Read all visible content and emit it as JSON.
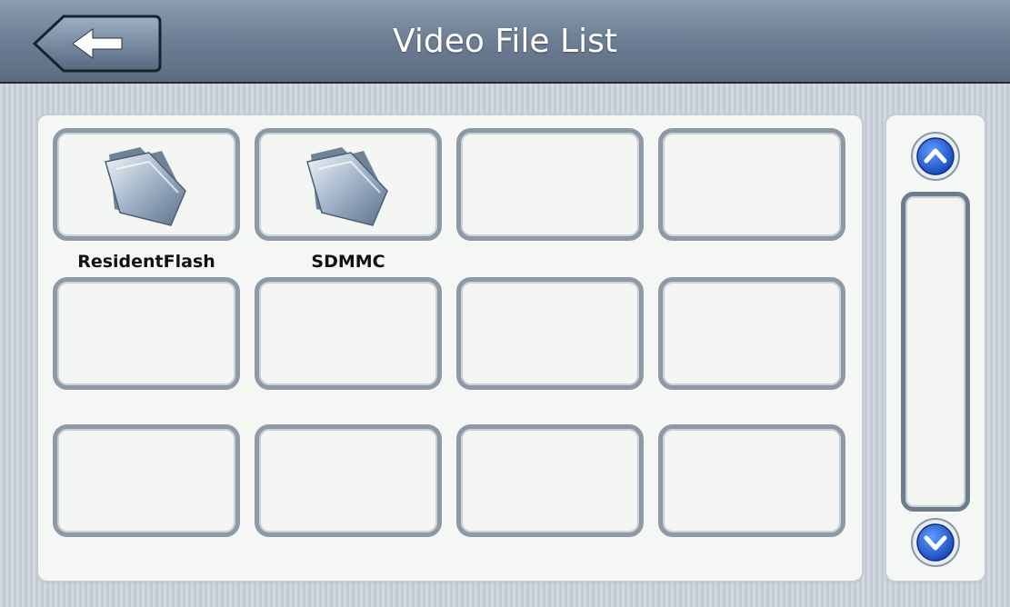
{
  "header": {
    "title": "Video File List",
    "back_icon": "back-arrow-icon"
  },
  "file_grid": {
    "items": [
      {
        "label": "ResidentFlash",
        "icon": "folder-icon"
      },
      {
        "label": "SDMMC",
        "icon": "folder-icon"
      },
      {
        "label": "",
        "icon": ""
      },
      {
        "label": "",
        "icon": ""
      },
      {
        "label": "",
        "icon": ""
      },
      {
        "label": "",
        "icon": ""
      },
      {
        "label": "",
        "icon": ""
      },
      {
        "label": "",
        "icon": ""
      },
      {
        "label": "",
        "icon": ""
      },
      {
        "label": "",
        "icon": ""
      },
      {
        "label": "",
        "icon": ""
      },
      {
        "label": "",
        "icon": ""
      }
    ]
  },
  "scrollbar": {
    "up_icon": "chevron-up-icon",
    "down_icon": "chevron-down-icon"
  },
  "colors": {
    "title_bar": "#6f8096",
    "accent_blue": "#1f5fd6"
  }
}
